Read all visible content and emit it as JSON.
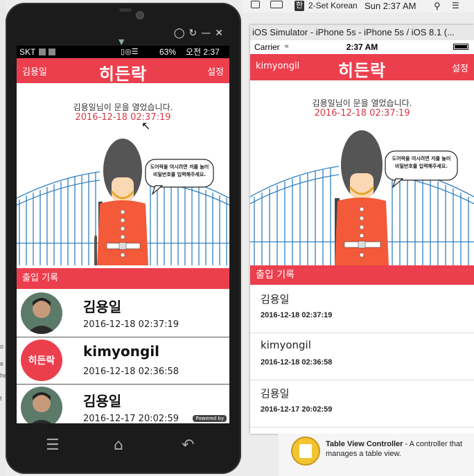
{
  "mac_menubar": {
    "input_source": "2-Set Korean",
    "clock": "Sun 2:37 AM"
  },
  "android": {
    "status": {
      "carrier": "SKT",
      "battery": "63%",
      "time": "오전 2:37"
    },
    "header": {
      "left": "김용일",
      "logo": "히든락",
      "right": "설정"
    },
    "door_message": "김용일님이 문을 열었습니다.",
    "door_time": "2016-12-18 02:37:19",
    "speech_bubble": [
      "도어락을 여시려면 저를 눌러",
      "비밀번호를 입력해주세요."
    ],
    "section_title": "출입 기록",
    "logs": [
      {
        "name": "김용일",
        "time": "2016-12-18 02:37:19",
        "avatar": "person-photo"
      },
      {
        "name": "kimyongil",
        "time": "2016-12-18 02:36:58",
        "avatar": "히든락"
      },
      {
        "name": "김용일",
        "time": "2016-12-17 20:02:59",
        "avatar": "person-photo"
      }
    ],
    "powered_by": "Powered by"
  },
  "ios_sim": {
    "window_title": "iOS Simulator - iPhone 5s - iPhone 5s / iOS 8.1 (...",
    "status": {
      "carrier": "Carrier",
      "time": "2:37 AM"
    },
    "header": {
      "left": "kimyongil",
      "logo": "히든락",
      "right": "설정"
    },
    "door_message": "김용일님이 문을 열었습니다.",
    "door_time": "2016-12-18 02:37:19",
    "speech_bubble": [
      "도어락을 여시려면 저를 눌러",
      "비밀번호를 입력해주세요."
    ],
    "section_title": "출입 기록",
    "logs": [
      {
        "name": "김용일",
        "time": "2016-12-18 02:37:19"
      },
      {
        "name": "kimyongil",
        "time": "2016-12-18 02:36:58"
      },
      {
        "name": "김용일",
        "time": "2016-12-17 20:02:59"
      }
    ]
  },
  "xcode": {
    "object_title": "Table View Controller",
    "object_desc": " - A controller that manages a table view."
  },
  "colors": {
    "accent": "#ec3f4e",
    "time_red": "#d73745"
  }
}
